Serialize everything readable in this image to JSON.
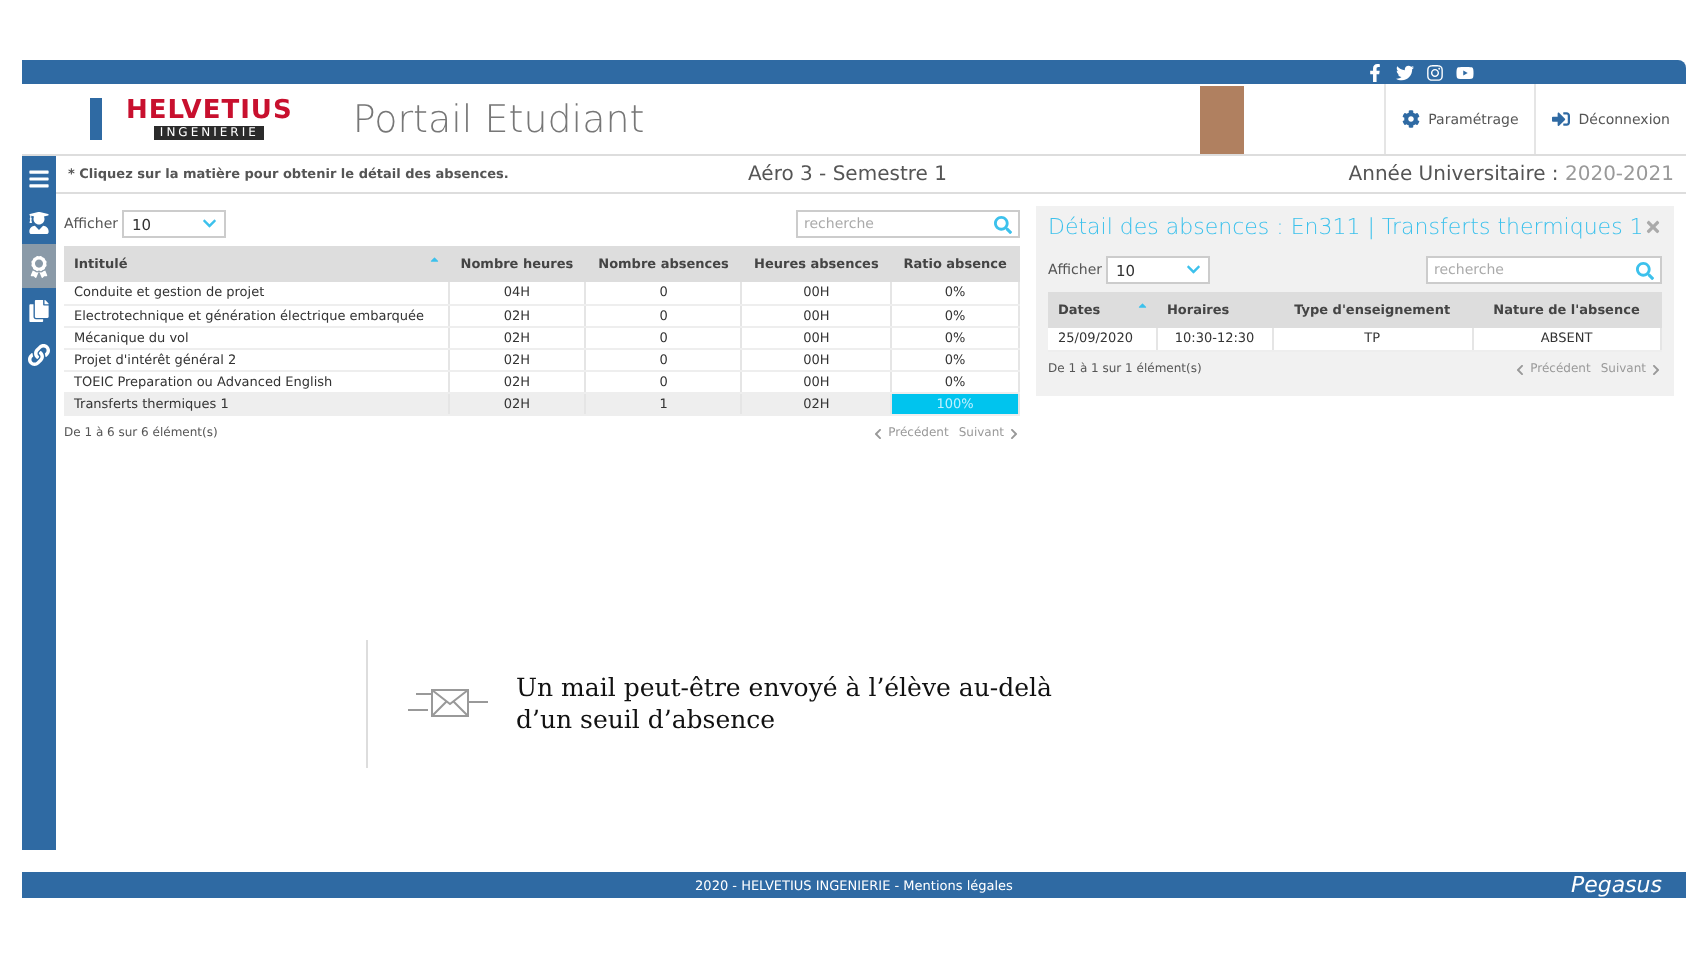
{
  "header": {
    "logo": {
      "name": "HELVETIUS",
      "tagline": "INGENIERIE"
    },
    "title": "Portail Etudiant",
    "settings": "Paramétrage",
    "logout": "Déconnexion"
  },
  "sidebar": {
    "items": [
      {
        "selected": false
      },
      {
        "selected": false
      },
      {
        "selected": true
      },
      {
        "selected": false
      },
      {
        "selected": false
      }
    ]
  },
  "info_bar": {
    "hint": "* Cliquez sur la matière pour obtenir le détail des absences.",
    "class": "Aéro 3 - Semestre 1",
    "year_label": "Année Universitaire : ",
    "year": "2020-2021"
  },
  "absences_table": {
    "show_label": "Afficher",
    "page_size": "10",
    "search_placeholder": "recherche",
    "columns": [
      "Intitulé",
      "Nombre heures",
      "Nombre absences",
      "Heures absences",
      "Ratio absence"
    ],
    "rows": [
      {
        "subject": "Conduite et gestion de projet",
        "hours": "04H",
        "absences": "0",
        "absence_hours": "00H",
        "ratio": "0%",
        "alert": false,
        "selected": false
      },
      {
        "subject": "Electrotechnique et génération électrique embarquée",
        "hours": "02H",
        "absences": "0",
        "absence_hours": "00H",
        "ratio": "0%",
        "alert": false,
        "selected": false
      },
      {
        "subject": "Mécanique du vol",
        "hours": "02H",
        "absences": "0",
        "absence_hours": "00H",
        "ratio": "0%",
        "alert": false,
        "selected": false
      },
      {
        "subject": "Projet d'intérêt général 2",
        "hours": "02H",
        "absences": "0",
        "absence_hours": "00H",
        "ratio": "0%",
        "alert": false,
        "selected": false
      },
      {
        "subject": "TOEIC Preparation ou Advanced English",
        "hours": "02H",
        "absences": "0",
        "absence_hours": "00H",
        "ratio": "0%",
        "alert": false,
        "selected": false
      },
      {
        "subject": "Transferts thermiques 1",
        "hours": "02H",
        "absences": "1",
        "absence_hours": "02H",
        "ratio": "100%",
        "alert": true,
        "selected": true
      }
    ],
    "summary": "De 1 à 6 sur 6 élément(s)",
    "previous": "Précédent",
    "next": "Suivant"
  },
  "detail_panel": {
    "title": "Détail des absences : En311 | Transferts thermiques 1",
    "show_label": "Afficher",
    "page_size": "10",
    "search_placeholder": "recherche",
    "columns": [
      "Dates",
      "Horaires",
      "Type d'enseignement",
      "Nature de l'absence"
    ],
    "rows": [
      {
        "date": "25/09/2020",
        "time": "10:30-12:30",
        "type": "TP",
        "nature": "ABSENT"
      }
    ],
    "summary": "De 1 à 1 sur 1 élément(s)",
    "previous": "Précédent",
    "next": "Suivant"
  },
  "callout": "Un mail peut-être envoyé à l’élève au-delà d’un seuil d’absence",
  "footer": {
    "text": "2020 - HELVETIUS INGENIERIE - Mentions légales",
    "brand": "Pegasus"
  }
}
